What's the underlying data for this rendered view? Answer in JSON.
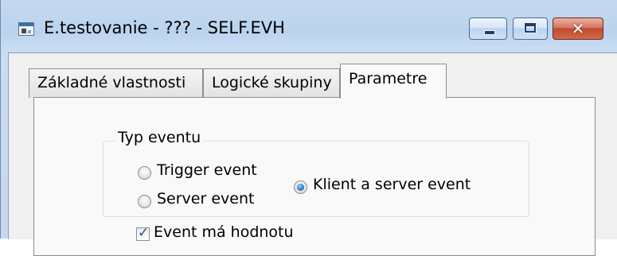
{
  "window": {
    "title": "E.testovanie - ??? - SELF.EVH",
    "close_glyph": "✕",
    "icon": "application-icon"
  },
  "tabs": [
    {
      "label": "Základné vlastnosti",
      "active": false
    },
    {
      "label": "Logické skupiny",
      "active": false
    },
    {
      "label": "Parametre",
      "active": true
    }
  ],
  "event_type_group": {
    "label": "Typ eventu",
    "options": [
      {
        "label": "Trigger event",
        "selected": false
      },
      {
        "label": "Server event",
        "selected": false
      },
      {
        "label": "Klient a server event",
        "selected": true
      }
    ]
  },
  "has_value": {
    "label": "Event má hodnotu",
    "checked": true
  },
  "colors": {
    "titlebar": "#bad3ee",
    "close_button": "#c24a2f",
    "radio_selected": "#2d7fd0"
  }
}
